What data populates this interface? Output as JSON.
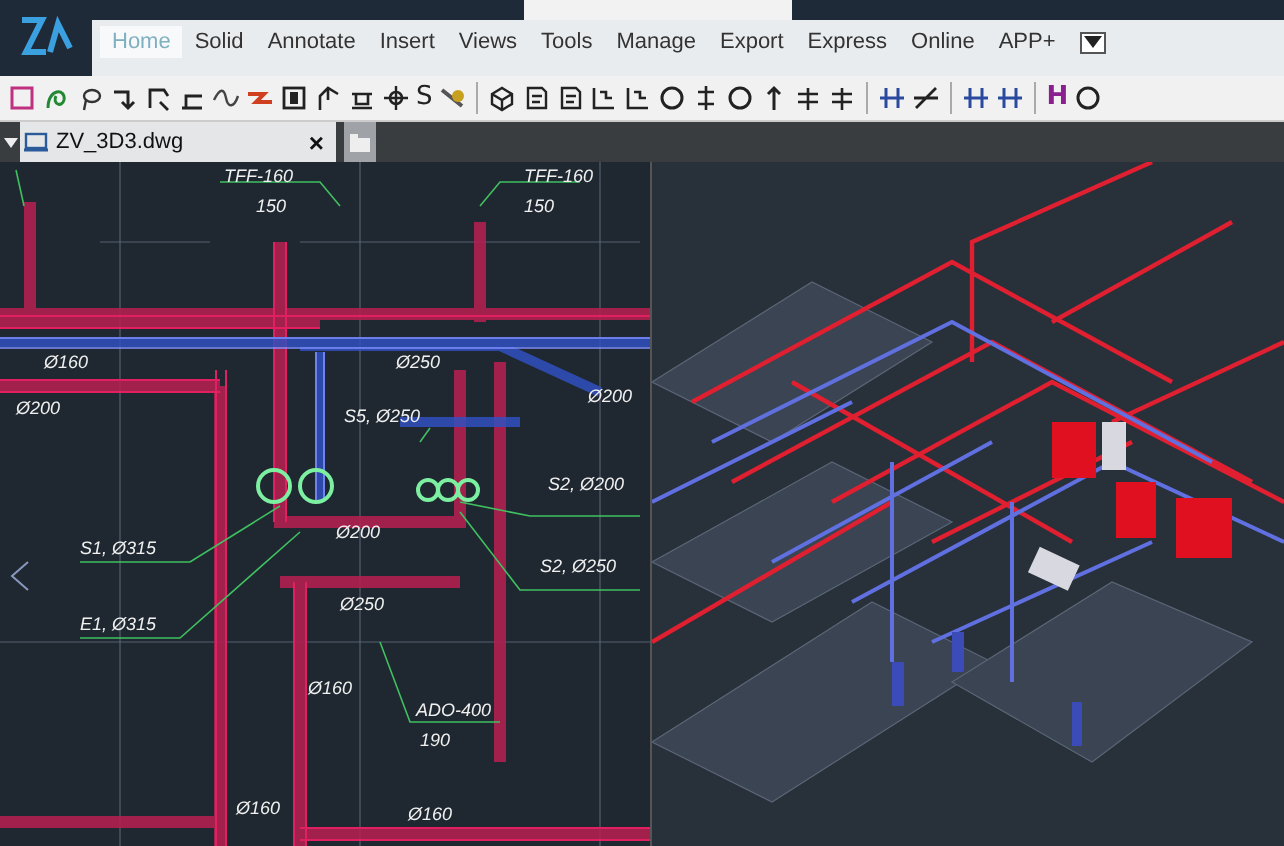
{
  "ribbon_tabs": [
    {
      "label": "Home",
      "selected": true
    },
    {
      "label": "Solid",
      "selected": false
    },
    {
      "label": "Annotate",
      "selected": false
    },
    {
      "label": "Insert",
      "selected": false
    },
    {
      "label": "Views",
      "selected": false
    },
    {
      "label": "Tools",
      "selected": false
    },
    {
      "label": "Manage",
      "selected": false
    },
    {
      "label": "Export",
      "selected": false
    },
    {
      "label": "Express",
      "selected": false
    },
    {
      "label": "Online",
      "selected": false
    },
    {
      "label": "APP+",
      "selected": false
    }
  ],
  "toolbar_letters": [
    "S",
    "H"
  ],
  "document_tabs": [
    {
      "label": "ZV_3D3.dwg",
      "close": "×",
      "selected": true
    }
  ],
  "drawing_labels": [
    "TFF-160",
    "150",
    "TFF-160",
    "150",
    "Ø160",
    "Ø250",
    "Ø200",
    "Ø200",
    "S5, Ø250",
    "S2, Ø200",
    "Ø200",
    "S1, Ø315",
    "S2, Ø250",
    "Ø250",
    "E1, Ø315",
    "Ø160",
    "ADO-400",
    "190",
    "Ø160",
    "Ø160"
  ]
}
